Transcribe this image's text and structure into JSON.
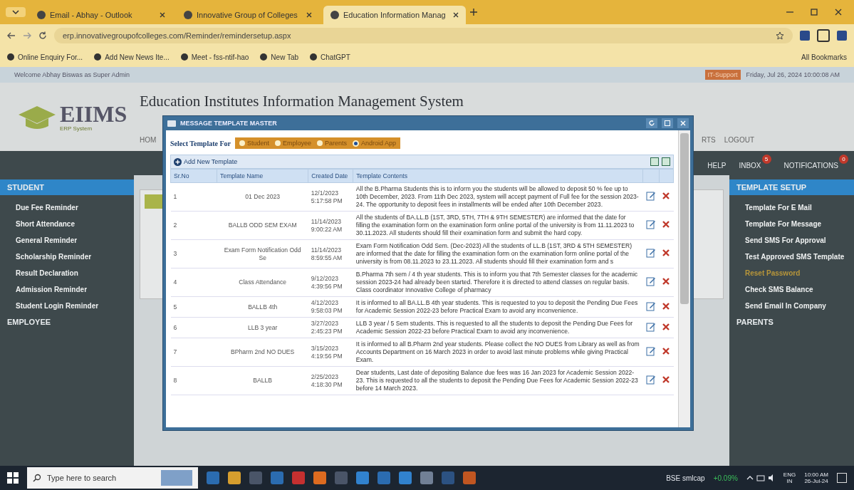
{
  "browser": {
    "tabs": [
      {
        "label": "Email - Abhay - Outlook",
        "selected": false
      },
      {
        "label": "Innovative Group of Colleges",
        "selected": false
      },
      {
        "label": "Education Information Manag",
        "selected": true
      }
    ],
    "url": "erp.innovativegroupofcolleges.com/Reminder/remindersetup.aspx",
    "bookmarks": [
      "Online Enquiry For...",
      "Add New News Ite...",
      "Meet - fss-ntif-hao",
      "New Tab",
      "ChatGPT"
    ],
    "all_bookmarks": "All Bookmarks"
  },
  "info_bar": {
    "welcome": "Welcome Abhay Biswas as Super Admin",
    "support": "IT-Support",
    "datetime": "Friday, Jul 26, 2024 10:00:08 AM"
  },
  "header": {
    "logo": "EIIMS",
    "logo_sub": "ERP System",
    "title": "Education Institutes Information Management System",
    "nav_left": "HOM",
    "nav_right": [
      "RTS",
      "LOGOUT"
    ]
  },
  "top_menu": [
    {
      "label": "HELP"
    },
    {
      "label": "INBOX",
      "badge": "5"
    },
    {
      "label": "NOTIFICATIONS",
      "badge": "0"
    }
  ],
  "left_sidebar": [
    {
      "title": "STUDENT",
      "selected": true,
      "items": [
        "Due Fee Reminder",
        "Short Attendance",
        "General Reminder",
        "Scholarship Reminder",
        "Result Declaration",
        "Admission Reminder",
        "Student Login Reminder"
      ]
    },
    {
      "title": "EMPLOYEE",
      "selected": false
    }
  ],
  "right_sidebar": [
    {
      "title": "TEMPLATE SETUP",
      "selected": true,
      "items": [
        {
          "label": "Template For E Mail",
          "selected": false
        },
        {
          "label": "Template For Message",
          "selected": false
        },
        {
          "label": "Send SMS For Approval",
          "selected": false
        },
        {
          "label": "Test Approved SMS Template",
          "selected": false
        },
        {
          "label": "Reset Password",
          "selected": true
        },
        {
          "label": "Check SMS Balance",
          "selected": false
        },
        {
          "label": "Send Email In Company",
          "selected": false
        }
      ]
    },
    {
      "title": "PARENTS",
      "selected": false
    }
  ],
  "modal": {
    "title": "MESSAGE TEMPLATE MASTER",
    "select_label": "Select Template For",
    "options": [
      {
        "label": "Student",
        "selected": false
      },
      {
        "label": "Employee",
        "selected": false
      },
      {
        "label": "Parents",
        "selected": false
      },
      {
        "label": "Android App",
        "selected": true
      }
    ],
    "add_button": "Add New Template",
    "columns": [
      "Sr.No",
      "Template Name",
      "Created Date",
      "Template Contents"
    ],
    "rows": [
      {
        "sr": "1",
        "name": "01 Dec 2023",
        "date": "12/1/2023",
        "time": "5:17:58 PM",
        "contents": "All the B.Pharma Students this is to inform you the students will be allowed to deposit 50 % fee up to 10th December, 2023. From 11th Dec 2023, system will accept payment of Full fee for the session 2023-24. The opportunity to deposit fees in installments will be ended after 10th December 2023."
      },
      {
        "sr": "2",
        "name": "BALLB ODD SEM EXAM",
        "date": "11/14/2023",
        "time": "9:00:22 AM",
        "contents": "All the students of BA.LL.B (1ST, 3RD, 5TH, 7TH & 9TH SEMESTER) are informed that the date for filling the examination form on the examination form online portal of the university is from 11.11.2023 to 30.11.2023. All students should fill their examination form and submit the hard copy."
      },
      {
        "sr": "3",
        "name": "Exam Form Notification Odd Se",
        "date": "11/14/2023",
        "time": "8:59:55 AM",
        "contents": "Exam Form Notification Odd Sem. (Dec-2023) All the students of LL.B (1ST, 3RD & 5TH SEMESTER) are informed that the date for filling the examination form on the examination form online portal of the university is from 08.11.2023 to 23.11.2023. All students should fill their examination form and s"
      },
      {
        "sr": "4",
        "name": "Class Attendance",
        "date": "9/12/2023",
        "time": "4:39:56 PM",
        "contents": "B.Pharma 7th sem / 4 th year students. This is to inform you that 7th Semester classes for the academic session 2023-24 had already been started. Therefore it is directed to attend classes on regular basis. Class coordinator Innovative College of pharmacy"
      },
      {
        "sr": "5",
        "name": "BALLB 4th",
        "date": "4/12/2023",
        "time": "9:58:03 PM",
        "contents": "It is informed to all BA.LL.B 4th year students. This is requested to you to deposit the Pending Due Fees for Academic Session 2022-23 before Practical Exam to avoid any inconvenience."
      },
      {
        "sr": "6",
        "name": "LLB 3 year",
        "date": "3/27/2023",
        "time": "2:45:23 PM",
        "contents": "LLB 3 year / 5 Sem students. This is requested to all the students to deposit the Pending Due Fees for Academic Session 2022-23 before Practical Exam to avoid any inconvenience."
      },
      {
        "sr": "7",
        "name": "BPharm 2nd NO DUES",
        "date": "3/15/2023",
        "time": "4:19:56 PM",
        "contents": "It is informed to all B.Pharm 2nd year students. Please collect the NO DUES from Library as well as from Accounts Department on 16 March 2023 in order to avoid last minute problems while giving Practical Exam."
      },
      {
        "sr": "8",
        "name": "BALLB",
        "date": "2/25/2023",
        "time": "4:18:30 PM",
        "contents": "Dear students, Last date of depositing Balance due fees was 16 Jan 2023 for Academic Session 2022-23. This is requested to all the students to deposit the Pending Due Fees for Academic Session 2022-23 before 14 March 2023."
      }
    ]
  },
  "taskbar": {
    "search_placeholder": "Type here to search",
    "stock": "BSE smlcap",
    "stock_change": "+0.09%",
    "lang": "ENG",
    "region": "IN",
    "time": "10:00 AM",
    "date": "26-Jul-24"
  }
}
